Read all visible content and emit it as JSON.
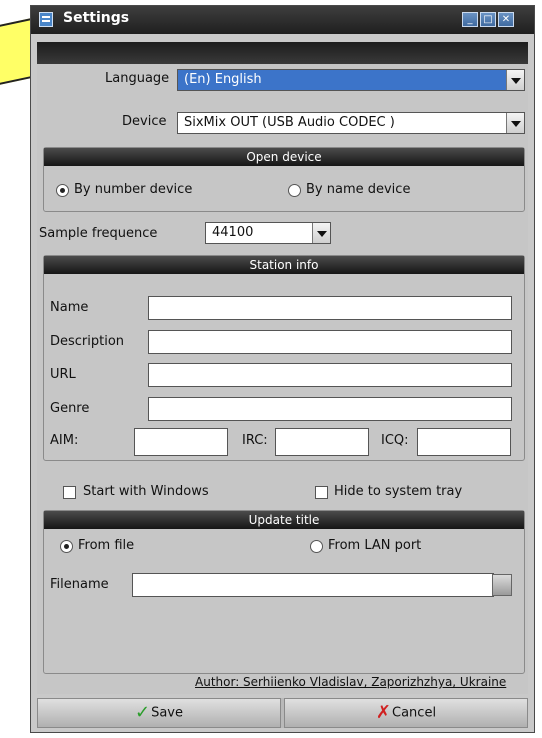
{
  "window": {
    "title": "Settings",
    "icon": "settings-window-icon"
  },
  "language": {
    "label": "Language",
    "value": "(En) English"
  },
  "device": {
    "label": "Device",
    "value": "SixMix OUT (USB Audio CODEC )"
  },
  "open_device": {
    "header": "Open device",
    "option_by_number": "By number device",
    "option_by_name": "By name device",
    "selected": "By number device"
  },
  "sample_frequence": {
    "label": "Sample frequence",
    "value": "44100"
  },
  "station_info": {
    "header": "Station info",
    "name_label": "Name",
    "description_label": "Description",
    "url_label": "URL",
    "genre_label": "Genre",
    "aim_label": "AIM:",
    "irc_label": "IRC:",
    "icq_label": "ICQ:"
  },
  "options": {
    "start_with_windows": "Start with Windows",
    "hide_to_tray": "Hide to system tray"
  },
  "update_title": {
    "header": "Update title",
    "option_from_file": "From file",
    "option_from_lan": "From LAN port",
    "selected": "From file",
    "filename_label": "Filename"
  },
  "author": "Author: Serhiienko Vladislav, Zaporizhzhya, Ukraine",
  "buttons": {
    "save_label": "Save",
    "cancel_label": "Cancel"
  },
  "colors": {
    "accent": "#3c74c9",
    "panel": "#c6c6c6",
    "header": "#1f1f1f"
  }
}
